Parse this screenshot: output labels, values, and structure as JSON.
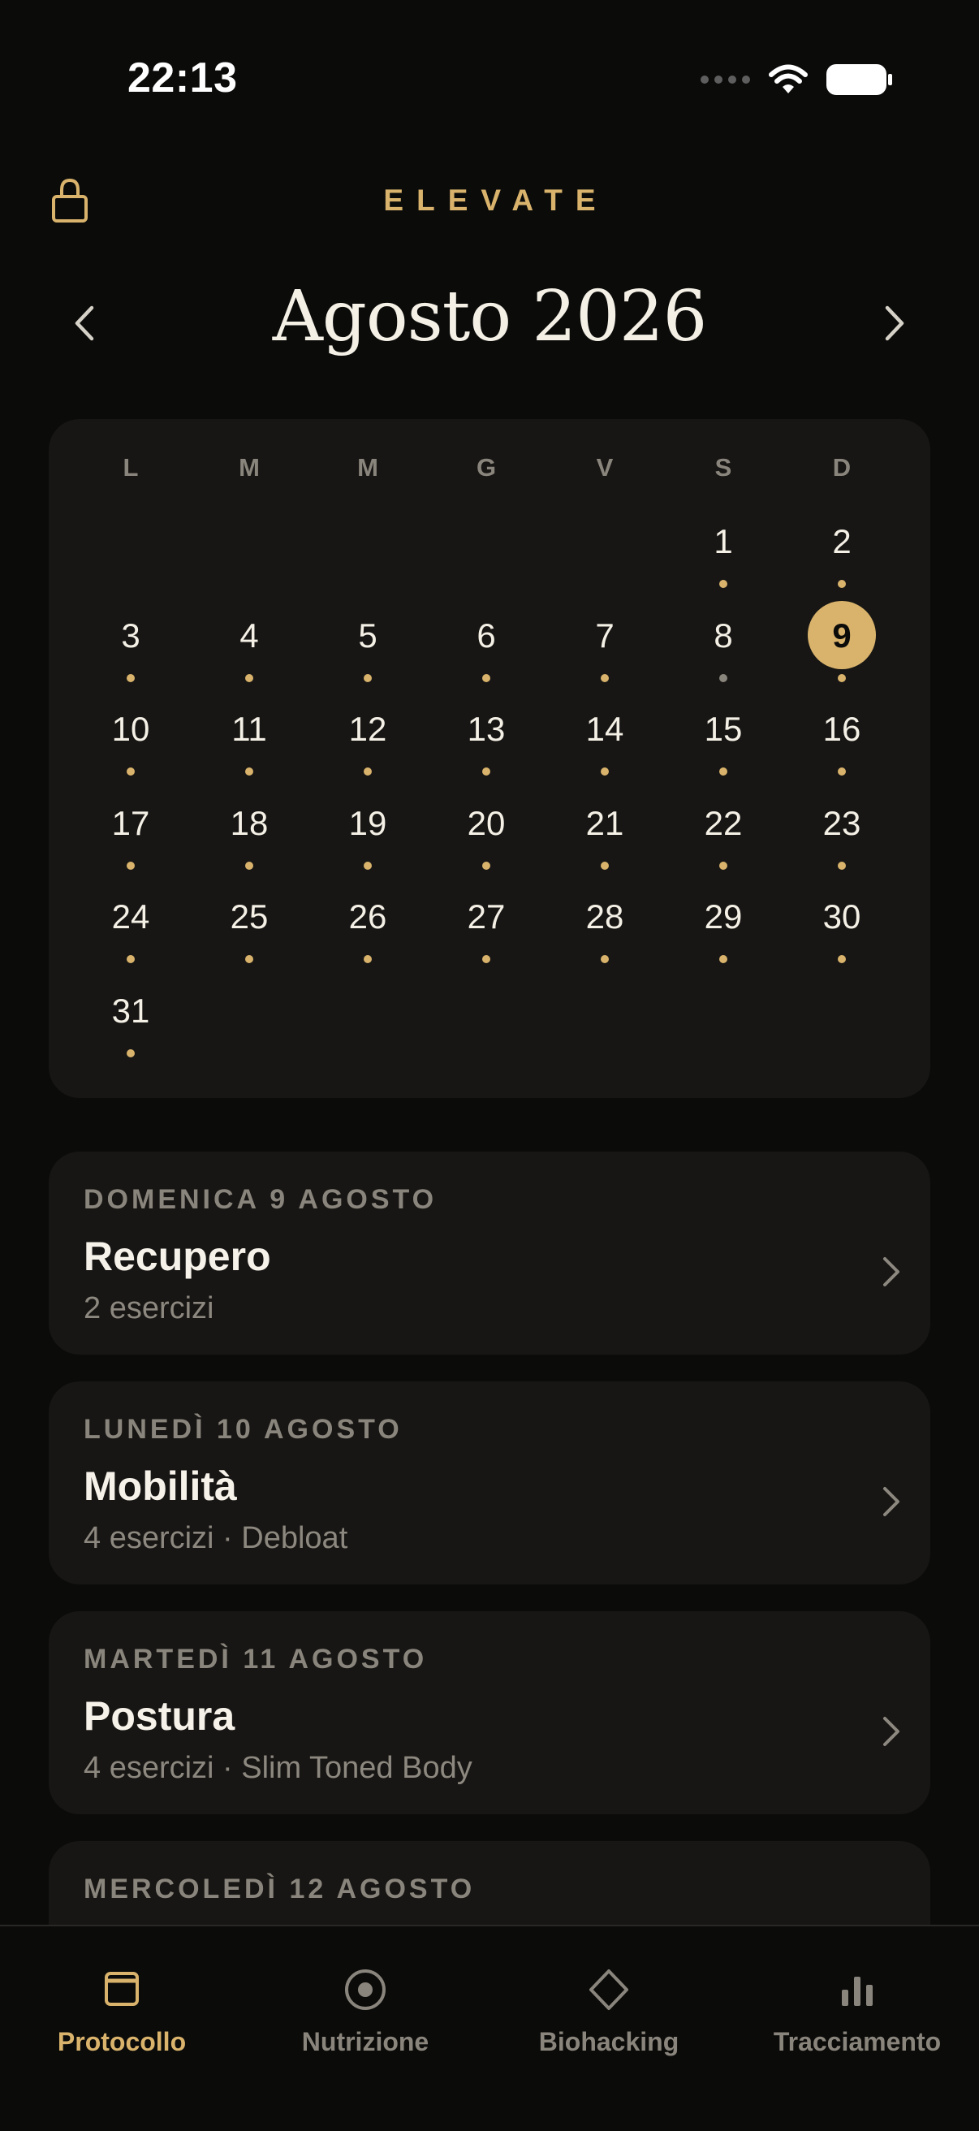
{
  "status_bar": {
    "time": "22:13"
  },
  "header": {
    "brand": "ELEVATE"
  },
  "month_nav": {
    "title": "Agosto 2026"
  },
  "calendar": {
    "weekdays": [
      "L",
      "M",
      "M",
      "G",
      "V",
      "S",
      "D"
    ],
    "selected_day": 9,
    "days": [
      {
        "n": "1"
      },
      {
        "n": "2"
      },
      {
        "n": "3"
      },
      {
        "n": "4"
      },
      {
        "n": "5"
      },
      {
        "n": "6"
      },
      {
        "n": "7"
      },
      {
        "n": "8",
        "dot": "grey"
      },
      {
        "n": "9",
        "selected": true
      },
      {
        "n": "10"
      },
      {
        "n": "11"
      },
      {
        "n": "12"
      },
      {
        "n": "13"
      },
      {
        "n": "14"
      },
      {
        "n": "15"
      },
      {
        "n": "16"
      },
      {
        "n": "17"
      },
      {
        "n": "18"
      },
      {
        "n": "19"
      },
      {
        "n": "20"
      },
      {
        "n": "21"
      },
      {
        "n": "22"
      },
      {
        "n": "23"
      },
      {
        "n": "24"
      },
      {
        "n": "25"
      },
      {
        "n": "26"
      },
      {
        "n": "27"
      },
      {
        "n": "28"
      },
      {
        "n": "29"
      },
      {
        "n": "30"
      },
      {
        "n": "31"
      }
    ],
    "colors": {
      "accent": "#d9b36c",
      "dot_past": "#8a857c"
    }
  },
  "sessions": [
    {
      "date": "DOMENICA 9 AGOSTO",
      "title": "Recupero",
      "subtitle": "2 esercizi"
    },
    {
      "date": "LUNEDÌ 10 AGOSTO",
      "title": "Mobilità",
      "subtitle": "4 esercizi · Debloat"
    },
    {
      "date": "MARTEDÌ 11 AGOSTO",
      "title": "Postura",
      "subtitle": "4 esercizi · Slim Toned Body"
    },
    {
      "date": "MERCOLEDÌ 12 AGOSTO"
    }
  ],
  "tab_bar": {
    "tabs": [
      {
        "label": "Protocollo",
        "icon": "calendar-icon",
        "active": true
      },
      {
        "label": "Nutrizione",
        "icon": "target-icon"
      },
      {
        "label": "Biohacking",
        "icon": "diamond-icon"
      },
      {
        "label": "Tracciamento",
        "icon": "bar-chart-icon"
      }
    ]
  }
}
